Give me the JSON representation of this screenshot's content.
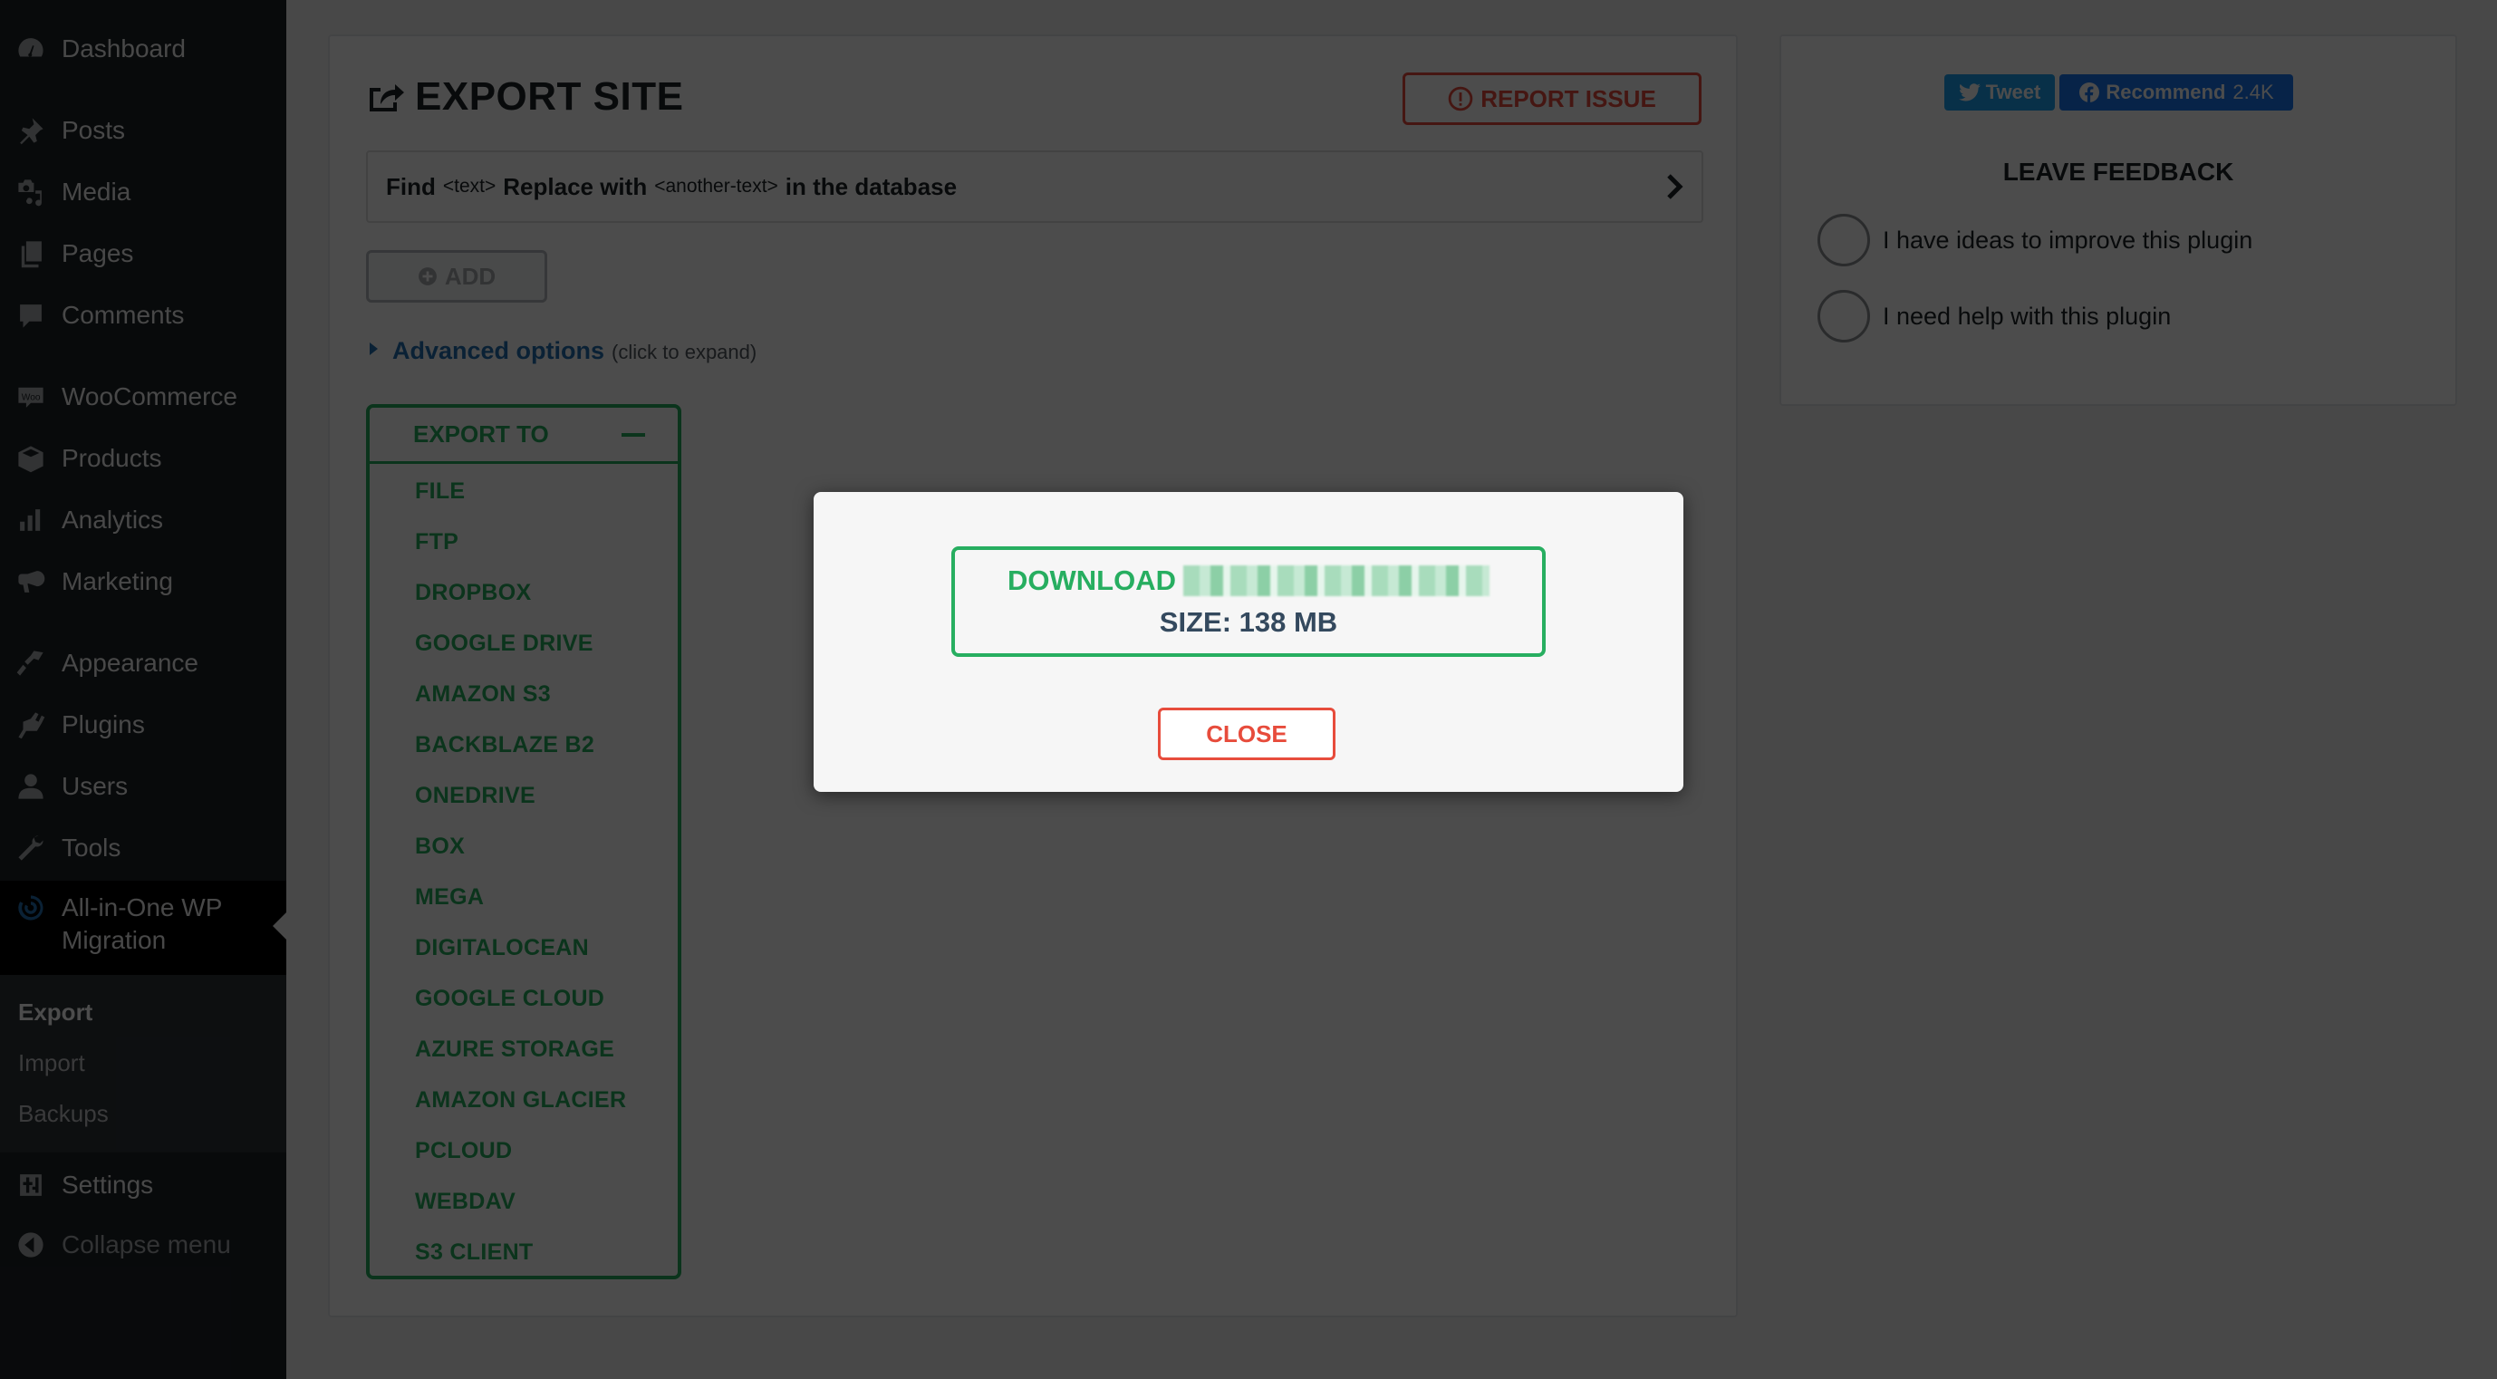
{
  "sidebar": {
    "items": [
      {
        "label": "Dashboard",
        "icon": "dashboard-icon"
      },
      {
        "label": "Posts",
        "icon": "pin-icon"
      },
      {
        "label": "Media",
        "icon": "media-icon"
      },
      {
        "label": "Pages",
        "icon": "pages-icon"
      },
      {
        "label": "Comments",
        "icon": "comment-icon"
      },
      {
        "label": "WooCommerce",
        "icon": "woo-icon"
      },
      {
        "label": "Products",
        "icon": "box-icon"
      },
      {
        "label": "Analytics",
        "icon": "bar-chart-icon"
      },
      {
        "label": "Marketing",
        "icon": "megaphone-icon"
      },
      {
        "label": "Appearance",
        "icon": "paintbrush-icon"
      },
      {
        "label": "Plugins",
        "icon": "plug-icon"
      },
      {
        "label": "Users",
        "icon": "user-icon"
      },
      {
        "label": "Tools",
        "icon": "wrench-icon"
      },
      {
        "label": "All-in-One WP Migration",
        "icon": "migration-icon",
        "current": true
      },
      {
        "label": "Settings",
        "icon": "settings-icon"
      },
      {
        "label": "Collapse menu",
        "icon": "collapse-icon"
      }
    ],
    "submenu": [
      {
        "label": "Export",
        "active": true
      },
      {
        "label": "Import"
      },
      {
        "label": "Backups"
      }
    ]
  },
  "main": {
    "title": "EXPORT SITE",
    "report_issue": "REPORT ISSUE",
    "find_replace": {
      "find": "Find",
      "find_placeholder": "<text>",
      "replace": "Replace with",
      "replace_placeholder": "<another-text>",
      "suffix": "in the database"
    },
    "add_label": "ADD",
    "advanced": {
      "link": "Advanced options",
      "hint": "(click to expand)"
    },
    "export_to": {
      "label": "EXPORT TO",
      "options": [
        "FILE",
        "FTP",
        "DROPBOX",
        "GOOGLE DRIVE",
        "AMAZON S3",
        "BACKBLAZE B2",
        "ONEDRIVE",
        "BOX",
        "MEGA",
        "DIGITALOCEAN",
        "GOOGLE CLOUD",
        "AZURE STORAGE",
        "AMAZON GLACIER",
        "PCLOUD",
        "WEBDAV",
        "S3 CLIENT"
      ]
    }
  },
  "right_panel": {
    "tweet": "Tweet",
    "recommend": "Recommend",
    "recommend_count": "2.4K",
    "feedback_title": "LEAVE FEEDBACK",
    "options": [
      "I have ideas to improve this plugin",
      "I need help with this plugin"
    ]
  },
  "modal": {
    "download_label": "DOWNLOAD",
    "size": "SIZE: 138 MB",
    "close": "CLOSE"
  },
  "colors": {
    "accent_green": "#27ae60",
    "danger_red": "#e74c3c",
    "link_blue": "#2271b1",
    "twitter": "#1da1f2",
    "facebook": "#1877f2"
  }
}
